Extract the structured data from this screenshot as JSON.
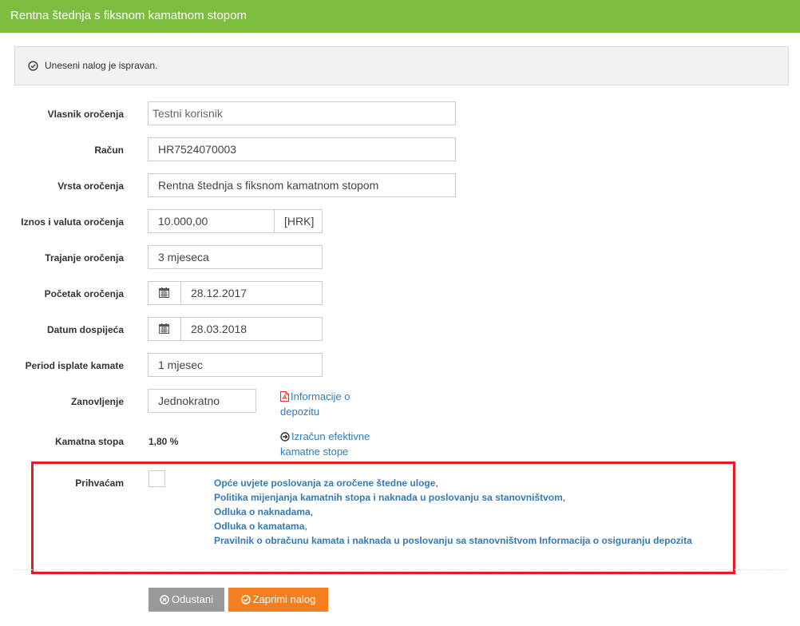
{
  "header": {
    "title": "Rentna štednja s fiksnom kamatnom stopom"
  },
  "alert": {
    "icon": "check-circle-icon",
    "text": "Uneseni nalog je ispravan."
  },
  "form": {
    "owner": {
      "label": "Vlasnik oročenja",
      "value": "Testni korisnik"
    },
    "account": {
      "label": "Račun",
      "value": "HR7524070003"
    },
    "type": {
      "label": "Vrsta oročenja",
      "value": "Rentna štednja s fiksnom kamatnom stopom"
    },
    "amount": {
      "label": "Iznos i valuta oročenja",
      "value": "10.000,00",
      "currency": "[HRK]"
    },
    "duration": {
      "label": "Trajanje oročenja",
      "value": "3 mjeseca"
    },
    "start": {
      "label": "Početak oročenja",
      "icon": "calendar-icon",
      "value": "28.12.2017"
    },
    "maturity": {
      "label": "Datum dospijeća",
      "icon": "calendar-icon",
      "value": "28.03.2018"
    },
    "interest_period": {
      "label": "Period isplate kamate",
      "value": "1 mjesec"
    },
    "renewal": {
      "label": "Zanovljenje",
      "value": "Jednokratno"
    },
    "rate": {
      "label": "Kamatna stopa",
      "value": "1,80 %"
    },
    "deposit_info_link": {
      "icon": "pdf-file-icon",
      "line1": "Informacije o",
      "line2": "depozitu"
    },
    "effective_rate_link": {
      "icon": "arrow-circle-right-icon",
      "line1": "Izračun efektivne",
      "line2": "kamatne stope"
    },
    "accept": {
      "label": "Prihvaćam",
      "checked": false,
      "terms": [
        {
          "text": "Opće uvjete poslovanja za oročene štedne uloge",
          "suffix": ","
        },
        {
          "text": "Politika mijenjanja kamatnih stopa i naknada u poslovanju sa stanovništvom",
          "suffix": ","
        },
        {
          "text": "Odluka o naknadama",
          "suffix": ","
        },
        {
          "text": "Odluka o kamatama",
          "suffix": ","
        },
        {
          "text": "Pravilnik o obračunu kamata i naknada u poslovanju sa stanovništvom Informacija o osiguranju depozita",
          "suffix": ""
        }
      ]
    }
  },
  "buttons": {
    "cancel": {
      "label": "Odustani",
      "icon": "cancel-circle-icon",
      "color": "#999999"
    },
    "submit": {
      "label": "Zaprimi nalog",
      "icon": "check-circle-icon",
      "color": "#f57f20"
    }
  },
  "colors": {
    "header": "#7cbd3f",
    "link": "#337ab7",
    "highlight_border": "#e31b23"
  }
}
